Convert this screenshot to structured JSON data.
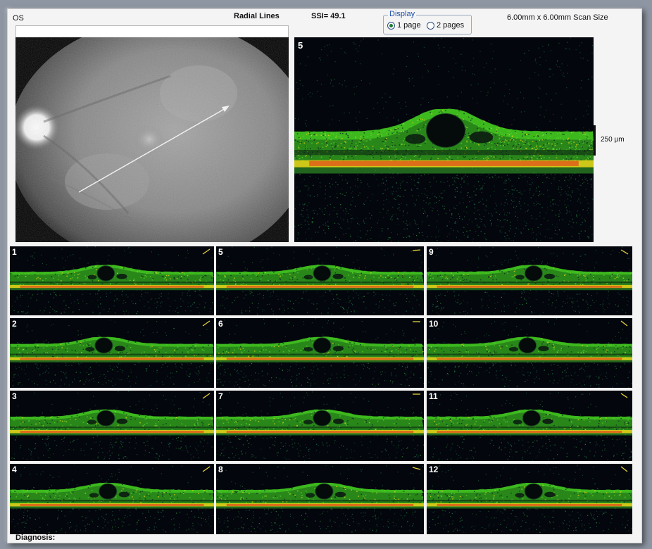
{
  "header": {
    "eye": "OS",
    "scan_mode": "Radial Lines",
    "ssi": "SSI= 49.1",
    "scan_size": "6.00mm x 6.00mm Scan Size"
  },
  "display": {
    "title": "Display",
    "options": [
      {
        "label": "1 page",
        "selected": true
      },
      {
        "label": "2 pages",
        "selected": false
      }
    ]
  },
  "main_scan": {
    "number": "5",
    "scale_label": "250 µm"
  },
  "thumbnails": [
    {
      "number": "1",
      "icon": "arrow-icon"
    },
    {
      "number": "5",
      "icon": "arrow-icon"
    },
    {
      "number": "9",
      "icon": "arrow-icon"
    },
    {
      "number": "2",
      "icon": "arrow-icon"
    },
    {
      "number": "6",
      "icon": "arrow-icon"
    },
    {
      "number": "10",
      "icon": "arrow-icon"
    },
    {
      "number": "3",
      "icon": "arrow-icon"
    },
    {
      "number": "7",
      "icon": "arrow-icon"
    },
    {
      "number": "11",
      "icon": "arrow-icon"
    },
    {
      "number": "4",
      "icon": "arrow-icon"
    },
    {
      "number": "8",
      "icon": "arrow-icon"
    },
    {
      "number": "12",
      "icon": "arrow-icon"
    }
  ],
  "footer": {
    "diagnosis_label": "Diagnosis:"
  },
  "colors": {
    "scan_green": "#3fbf1f",
    "scan_yellow": "#d8d21a",
    "scan_red": "#e0571a",
    "arrow_yellow": "#e6d23a",
    "fieldset_blue": "#1f4fa8"
  }
}
